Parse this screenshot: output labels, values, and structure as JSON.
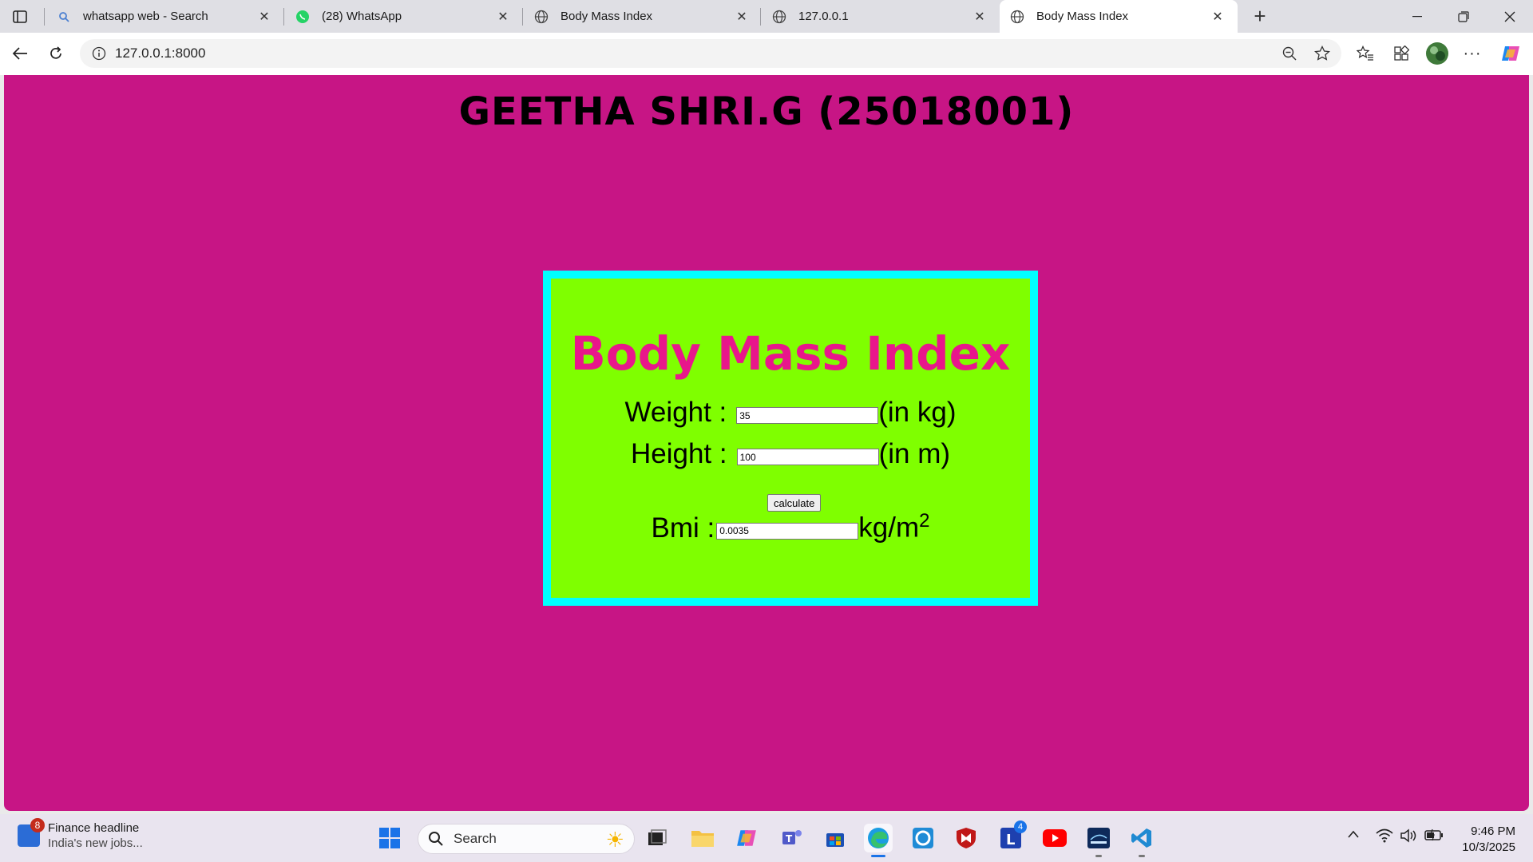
{
  "browser": {
    "tabs": [
      {
        "title": "whatsapp web - Search",
        "icon": "search-icon",
        "active": false
      },
      {
        "title": "(28) WhatsApp",
        "icon": "whatsapp-icon",
        "active": false
      },
      {
        "title": "Body Mass Index",
        "icon": "globe-icon",
        "active": false
      },
      {
        "title": "127.0.0.1",
        "icon": "globe-icon",
        "active": false
      },
      {
        "title": "Body Mass Index",
        "icon": "globe-icon",
        "active": true
      }
    ],
    "address": "127.0.0.1:8000"
  },
  "page": {
    "heading": "GEETHA SHRI.G (25018001)",
    "background": "#c71585",
    "card": {
      "title": "Body Mass Index",
      "title_color": "#e8178b",
      "background": "#7fff00",
      "border_color": "#00ffff",
      "weight_label": "Weight :",
      "weight_value": "35",
      "weight_unit": "(in kg)",
      "height_label": "Height :",
      "height_value": "100",
      "height_unit": "(in m)",
      "button_label": "calculate",
      "bmi_label": "Bmi :",
      "bmi_value": "0.0035",
      "bmi_unit": "kg/m",
      "bmi_unit_sup": "2"
    }
  },
  "taskbar": {
    "widget_title": "Finance headline",
    "widget_subtitle": "India's new jobs...",
    "widget_badge": "8",
    "search_label": "Search",
    "mail_badge": "4",
    "time": "9:46 PM",
    "date": "10/3/2025"
  }
}
